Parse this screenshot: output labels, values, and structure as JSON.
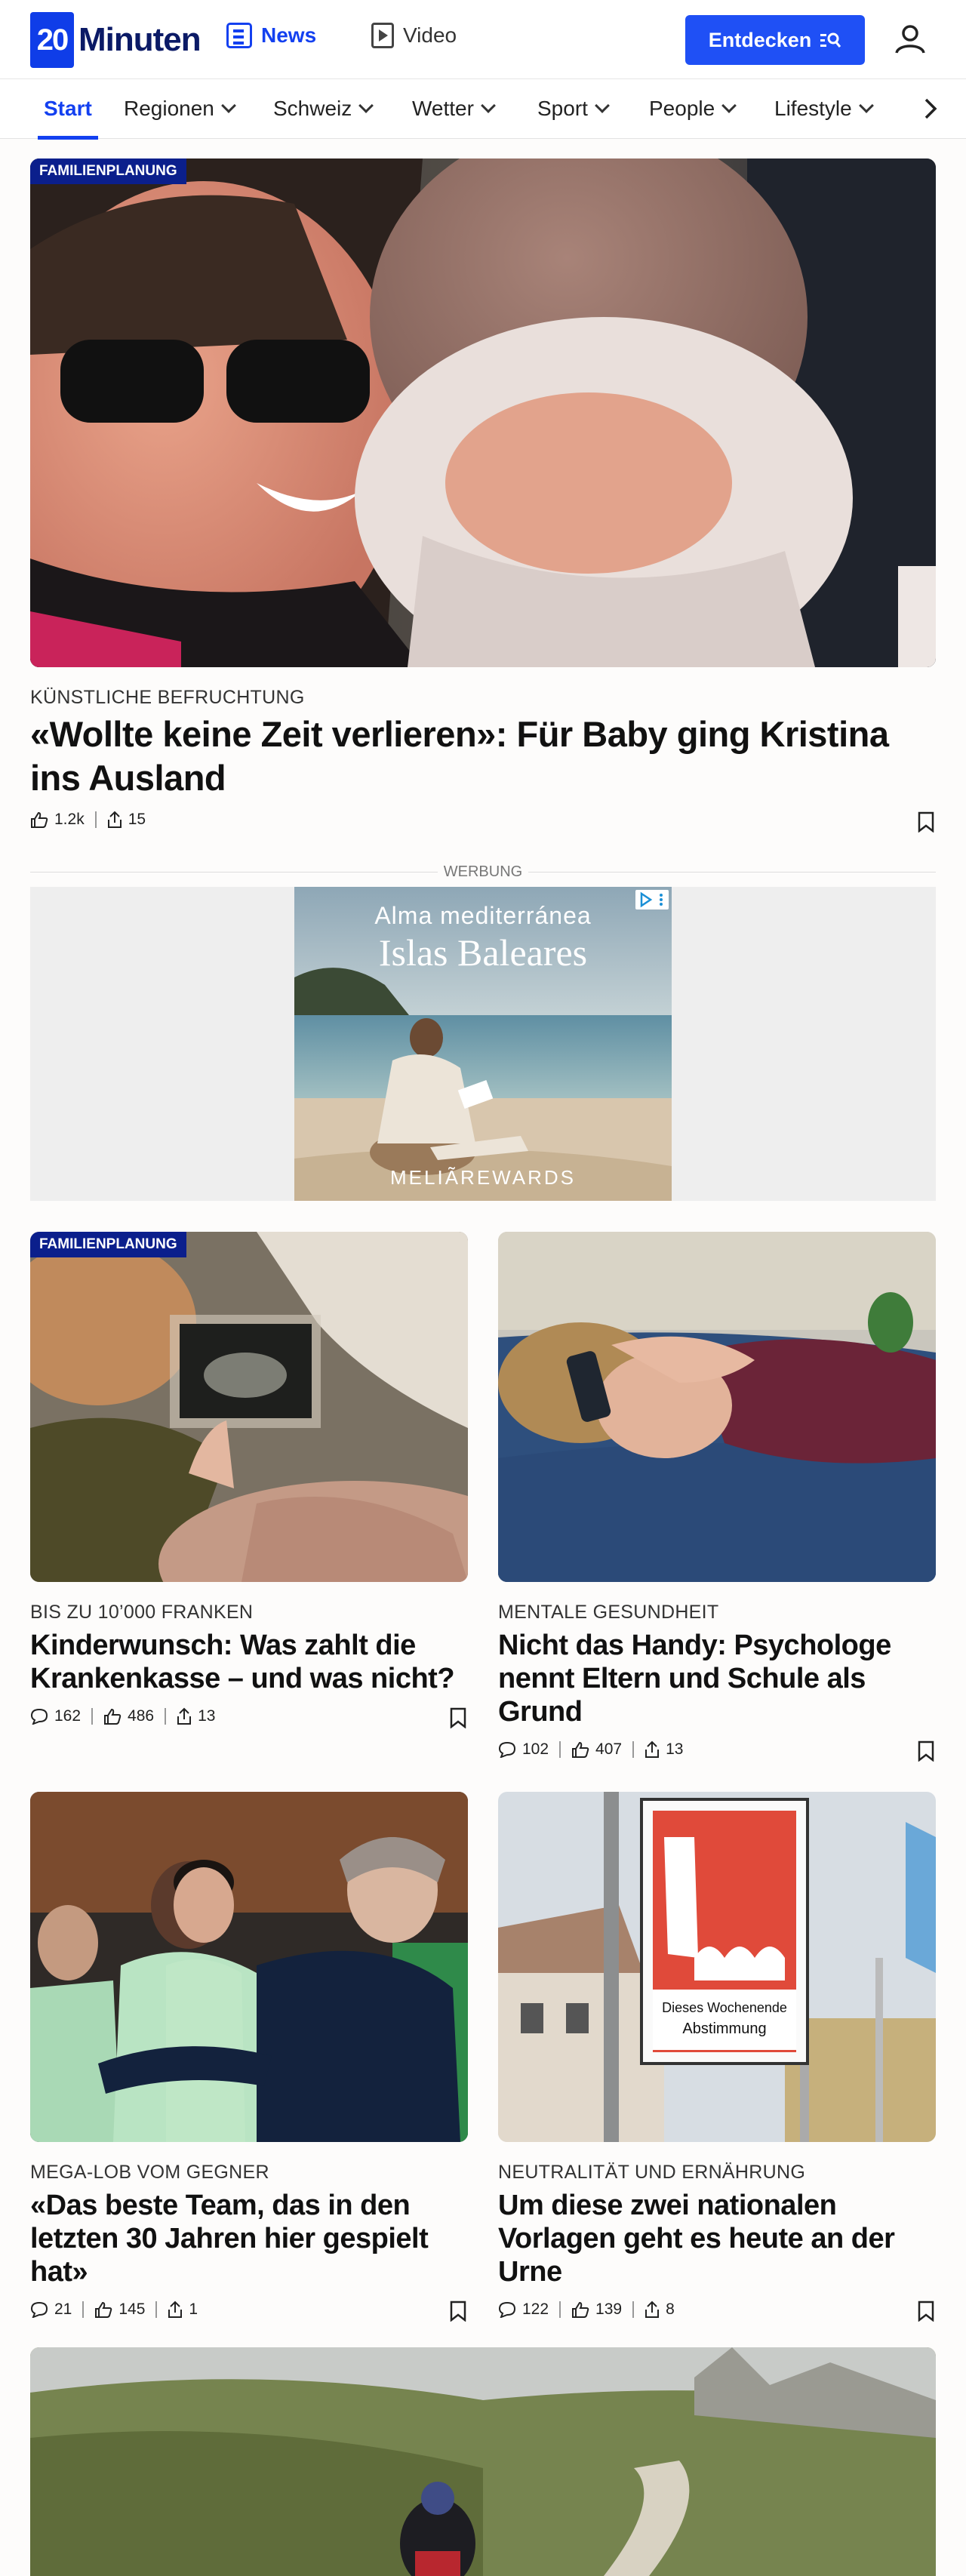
{
  "header": {
    "logo_number": "20",
    "logo_text": "Minuten",
    "news_label": "News",
    "video_label": "Video",
    "explore_label": "Entdecken"
  },
  "nav": {
    "items": [
      "Start",
      "Regionen",
      "Schweiz",
      "Wetter",
      "Sport",
      "People",
      "Lifestyle"
    ]
  },
  "hero": {
    "badge": "FAMILIENPLANUNG",
    "kicker": "KÜNSTLICHE BEFRUCHTUNG",
    "headline": "«Wollte keine Zeit verlieren»: Für Baby ging Kristina ins Ausland",
    "likes": "1.2k",
    "shares": "15"
  },
  "ad": {
    "label": "WERBUNG",
    "line1": "Alma mediterránea",
    "line2": "Islas Baleares",
    "brand": "MELIÃREWARDS"
  },
  "articles": [
    {
      "badge": "FAMILIENPLANUNG",
      "kicker": "BIS ZU 10’000 FRANKEN",
      "headline": "Kinderwunsch: Was zahlt die Krankenkasse – und was nicht?",
      "comments": "162",
      "likes": "486",
      "shares": "13"
    },
    {
      "kicker": "MENTALE GESUNDHEIT",
      "headline": "Nicht das Handy: Psychologe nennt Eltern und Schule als Grund",
      "comments": "102",
      "likes": "407",
      "shares": "13"
    },
    {
      "kicker": "MEGA-LOB VOM GEGNER",
      "headline": "«Das beste Team, das in den letzten 30 Jahren hier gespielt hat»",
      "comments": "21",
      "likes": "145",
      "shares": "1"
    },
    {
      "kicker": "NEUTRALITÄT UND ERNÄHRUNG",
      "headline": "Um diese zwei nationalen Vorlagen geht es heute an der Urne",
      "comments": "122",
      "likes": "139",
      "shares": "8",
      "sign_text_1": "Dieses Wochenende",
      "sign_text_2": "Abstimmung"
    }
  ],
  "colors": {
    "brand": "#1340f0",
    "badge": "#0b1f8c",
    "button": "#1f50f5"
  }
}
